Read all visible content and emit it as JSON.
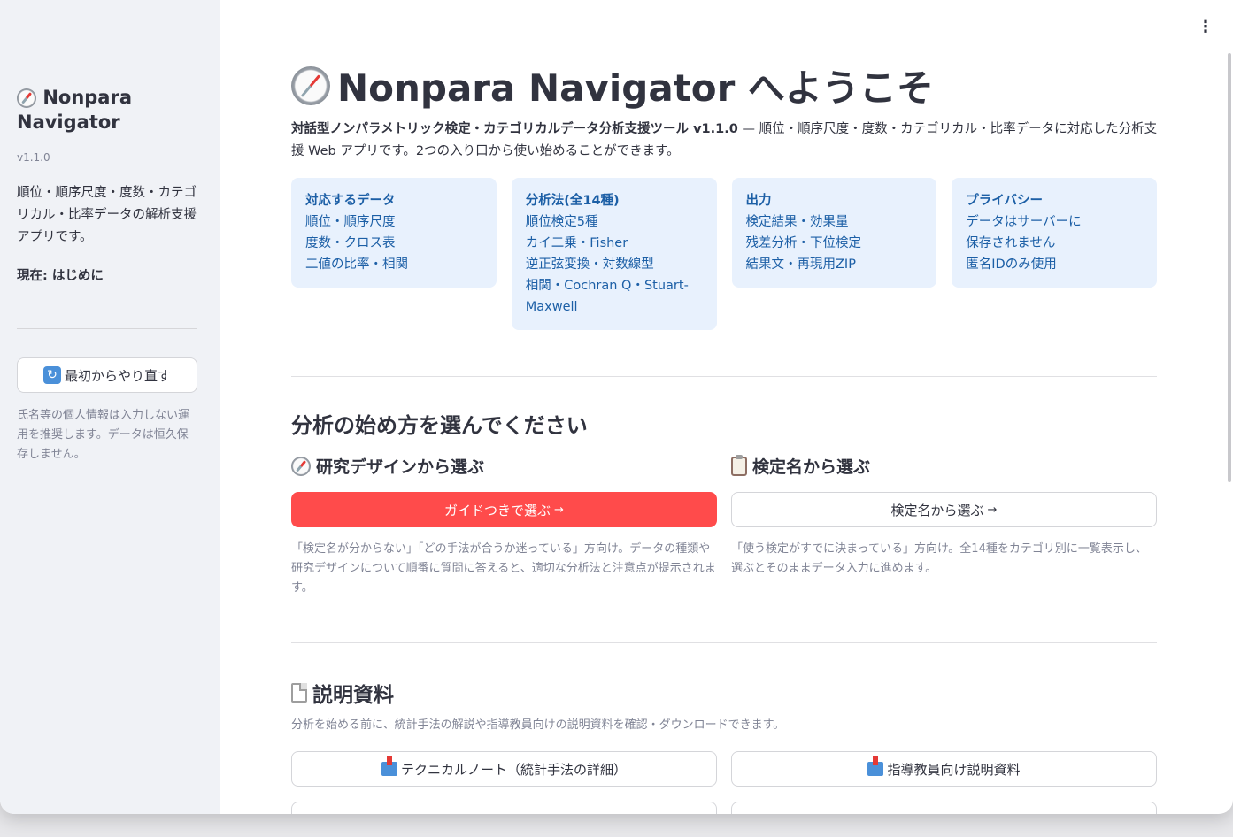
{
  "sidebar": {
    "title": "Nonpara Navigator",
    "version": "v1.1.0",
    "description": "順位・順序尺度・度数・カテゴリカル・比率データの解析支援アプリです。",
    "current": "現在: はじめに",
    "restart_label": "最初からやり直す",
    "note": "氏名等の個人情報は入力しない運用を推奨します。データは恒久保存しません。"
  },
  "main": {
    "menu_icon": "kebab-menu-icon",
    "title": "Nonpara Navigator へようこそ",
    "intro_bold": "対話型ノンパラメトリック検定・カテゴリカルデータ分析支援ツール v1.1.0",
    "intro_rest": " — 順位・順序尺度・度数・カテゴリカル・比率データに対応した分析支援 Web アプリです。2つの入り口から使い始めることができます。",
    "cards": [
      {
        "title": "対応するデータ",
        "lines": [
          "順位・順序尺度",
          "度数・クロス表",
          "二値の比率・相関"
        ]
      },
      {
        "title": "分析法(全14種)",
        "lines": [
          "順位検定5種",
          "カイ二乗・Fisher",
          "逆正弦変換・対数線型",
          "相関・Cochran Q・Stuart-Maxwell"
        ]
      },
      {
        "title": "出力",
        "lines": [
          "検定結果・効果量",
          "残差分析・下位検定",
          "結果文・再現用ZIP"
        ]
      },
      {
        "title": "プライバシー",
        "lines": [
          "データはサーバーに",
          "保存されません",
          "匿名IDのみ使用"
        ]
      }
    ],
    "section_start": "分析の始め方を選んでください",
    "design_heading": "研究デザインから選ぶ",
    "design_button": "ガイドつきで選ぶ",
    "design_caption": "「検定名が分からない」「どの手法が合うか迷っている」方向け。データの種類や研究デザインについて順番に質問に答えると、適切な分析法と注意点が提示されます。",
    "test_heading": "検定名から選ぶ",
    "test_button": "検定名から選ぶ",
    "test_caption": "「使う検定がすでに決まっている」方向け。全14種をカテゴリ別に一覧表示し、選ぶとそのままデータ入力に進めます。",
    "arrow": "→",
    "docs_heading": "説明資料",
    "docs_caption": "分析を始める前に、統計手法の解説や指導教員向けの説明資料を確認・ダウンロードできます。",
    "docs_buttons": [
      "テクニカルノート（統計手法の詳細）",
      "指導教員向け説明資料"
    ]
  }
}
